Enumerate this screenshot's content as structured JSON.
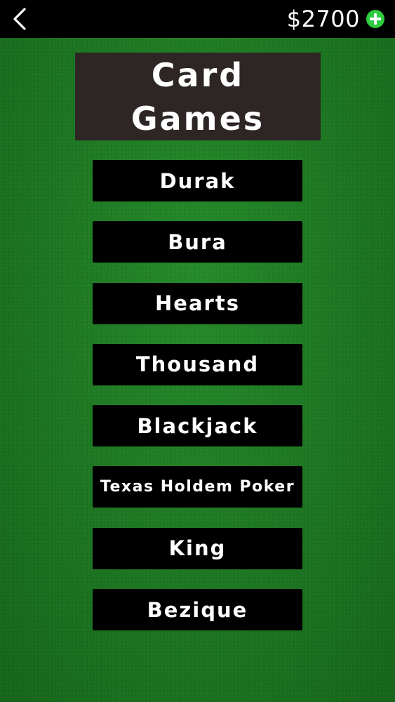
{
  "header": {
    "back_icon": "chevron-left-icon",
    "balance": "$2700",
    "add_icon": "plus-circle-icon",
    "add_icon_color": "#2ecc40"
  },
  "title": {
    "line1": "Card",
    "line2": "Games"
  },
  "games": [
    {
      "label": "Durak"
    },
    {
      "label": "Bura"
    },
    {
      "label": "Hearts"
    },
    {
      "label": "Thousand"
    },
    {
      "label": "Blackjack"
    },
    {
      "label": "Texas Holdem Poker"
    },
    {
      "label": "King"
    },
    {
      "label": "Bezique"
    }
  ],
  "colors": {
    "table_green": "#1d7a22",
    "title_bg": "#2d2624",
    "button_bg": "#000000",
    "text": "#ffffff"
  }
}
